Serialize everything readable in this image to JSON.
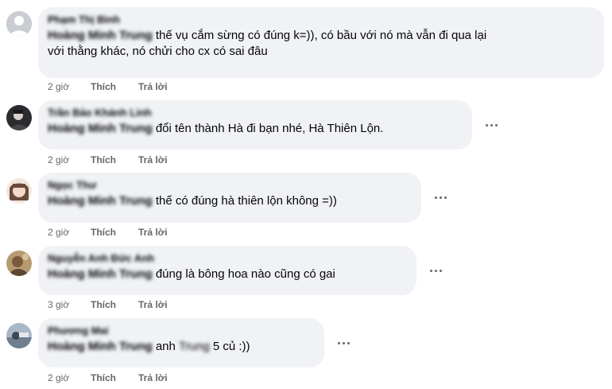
{
  "comments": [
    {
      "author": "Phạm Thị Bình",
      "mention": "Hoàng Minh Trung",
      "text_line1": " thế vụ cắm sừng có đúng k=)), có bầu với nó mà vẫn đi qua lại",
      "text_line2": "với thằng khác, nó chửi cho cx có sai đâu",
      "time": "2 giờ",
      "like": "Thích",
      "reply": "Trả lời",
      "avatar_color": "#c9ccd1"
    },
    {
      "author": "Trần Bảo Khánh Linh",
      "mention": "Hoàng Minh Trung",
      "text": " đổi tên thành Hà đi bạn nhé, Hà Thiên Lộn.",
      "time": "2 giờ",
      "like": "Thích",
      "reply": "Trả lời",
      "avatar_color": "#2b2b30"
    },
    {
      "author": "Ngọc Thư",
      "mention": "Hoàng Minh Trung",
      "text": " thế có đúng hà thiên lộn không =))",
      "time": "2 giờ",
      "like": "Thích",
      "reply": "Trả lời",
      "avatar_color": "#e8c9b6"
    },
    {
      "author": "Nguyễn Anh Đức Anh",
      "mention": "Hoàng Minh Trung",
      "text": " đúng là bông hoa nào cũng có gai",
      "time": "3 giờ",
      "like": "Thích",
      "reply": "Trả lời",
      "avatar_color": "#9a7a55"
    },
    {
      "author": "Phương Mai",
      "mention": "Hoàng Minh Trung",
      "text_pre": " anh ",
      "blurred_word": "Trung",
      "text_post": " 5 củ :))",
      "time": "2 giờ",
      "like": "Thích",
      "reply": "Trả lời",
      "avatar_color": "#7f93a8"
    }
  ],
  "more_icon": "more-horizontal-icon"
}
